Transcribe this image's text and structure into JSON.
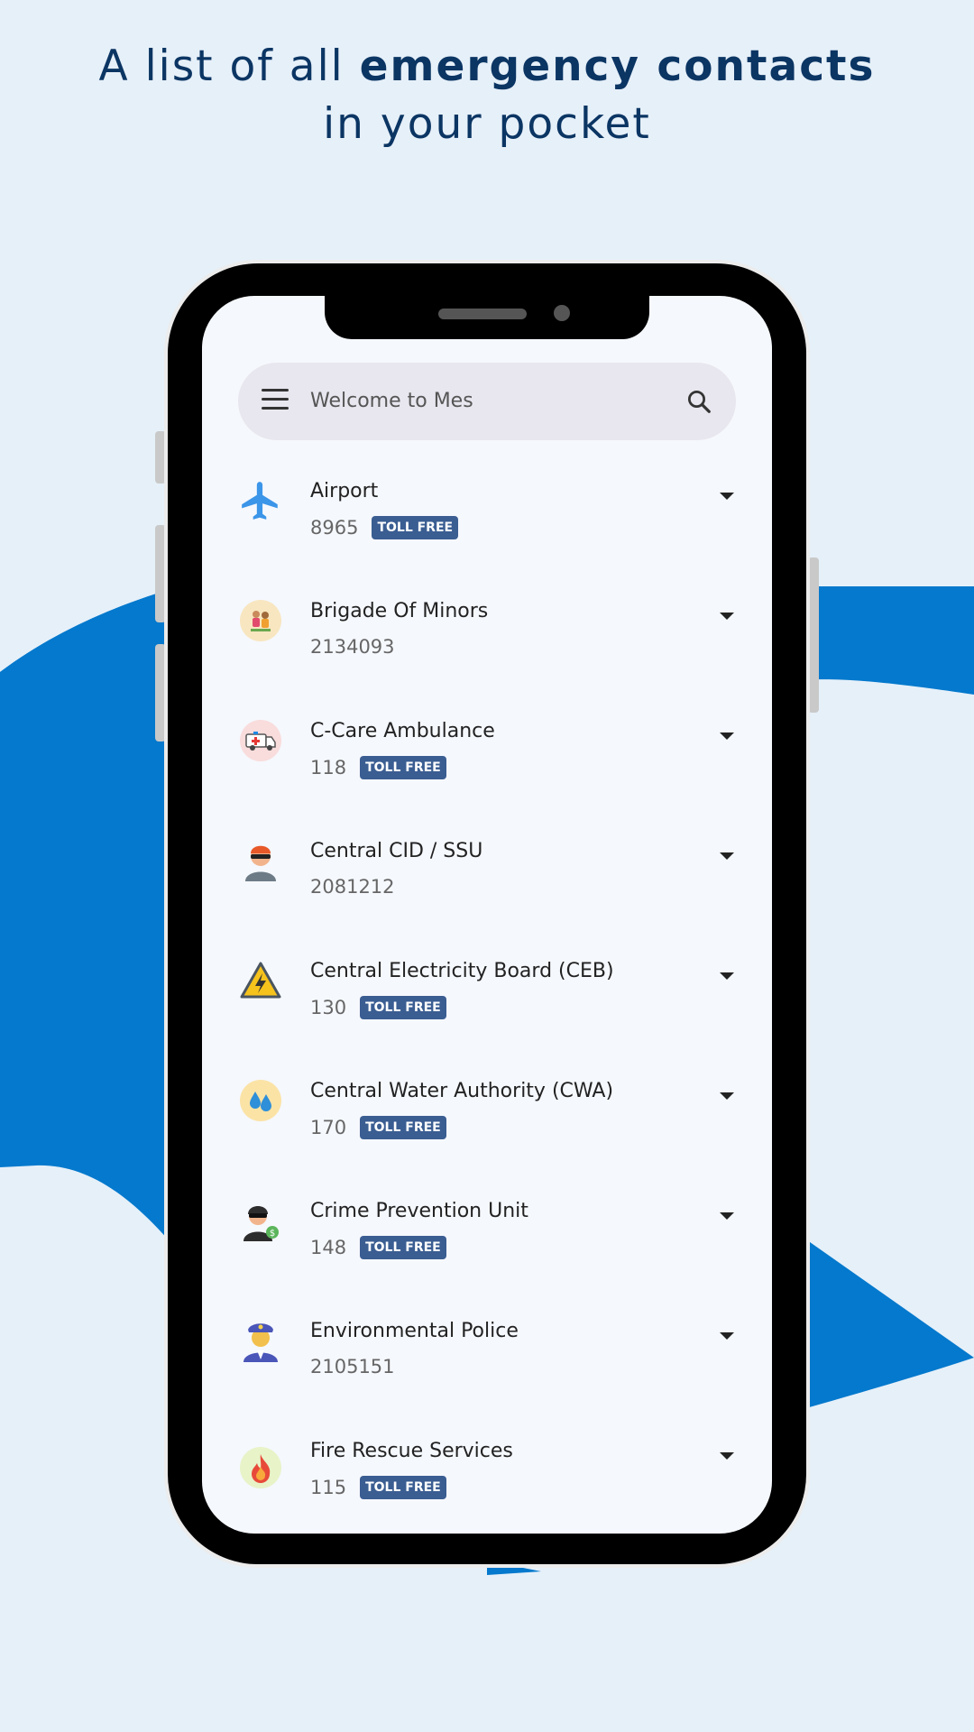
{
  "headline": {
    "prefix": "A list of all ",
    "bold": "emergency contacts",
    "line2": "in your pocket"
  },
  "colors": {
    "background": "#e6f0f9",
    "wave": "#0479cd",
    "headline": "#0b3563",
    "badge": "#3a5d92"
  },
  "search": {
    "placeholder": "Welcome to Mes",
    "menu_icon": "hamburger-menu-icon",
    "search_icon": "search-icon"
  },
  "badge_label": "TOLL FREE",
  "contacts": [
    {
      "name": "Airport",
      "number": "8965",
      "toll_free": true,
      "icon": "airplane-icon"
    },
    {
      "name": "Brigade Of Minors",
      "number": "2134093",
      "toll_free": false,
      "icon": "children-icon"
    },
    {
      "name": "C-Care Ambulance",
      "number": "118",
      "toll_free": true,
      "icon": "ambulance-icon"
    },
    {
      "name": "Central CID / SSU",
      "number": "2081212",
      "toll_free": false,
      "icon": "masked-agent-icon"
    },
    {
      "name": "Central Electricity Board (CEB)",
      "number": "130",
      "toll_free": true,
      "icon": "high-voltage-icon"
    },
    {
      "name": "Central Water Authority (CWA)",
      "number": "170",
      "toll_free": true,
      "icon": "water-drops-icon"
    },
    {
      "name": "Crime Prevention Unit",
      "number": "148",
      "toll_free": true,
      "icon": "thief-icon"
    },
    {
      "name": "Environmental Police",
      "number": "2105151",
      "toll_free": false,
      "icon": "police-officer-icon"
    },
    {
      "name": "Fire Rescue Services",
      "number": "115",
      "toll_free": true,
      "icon": "fire-icon"
    }
  ]
}
